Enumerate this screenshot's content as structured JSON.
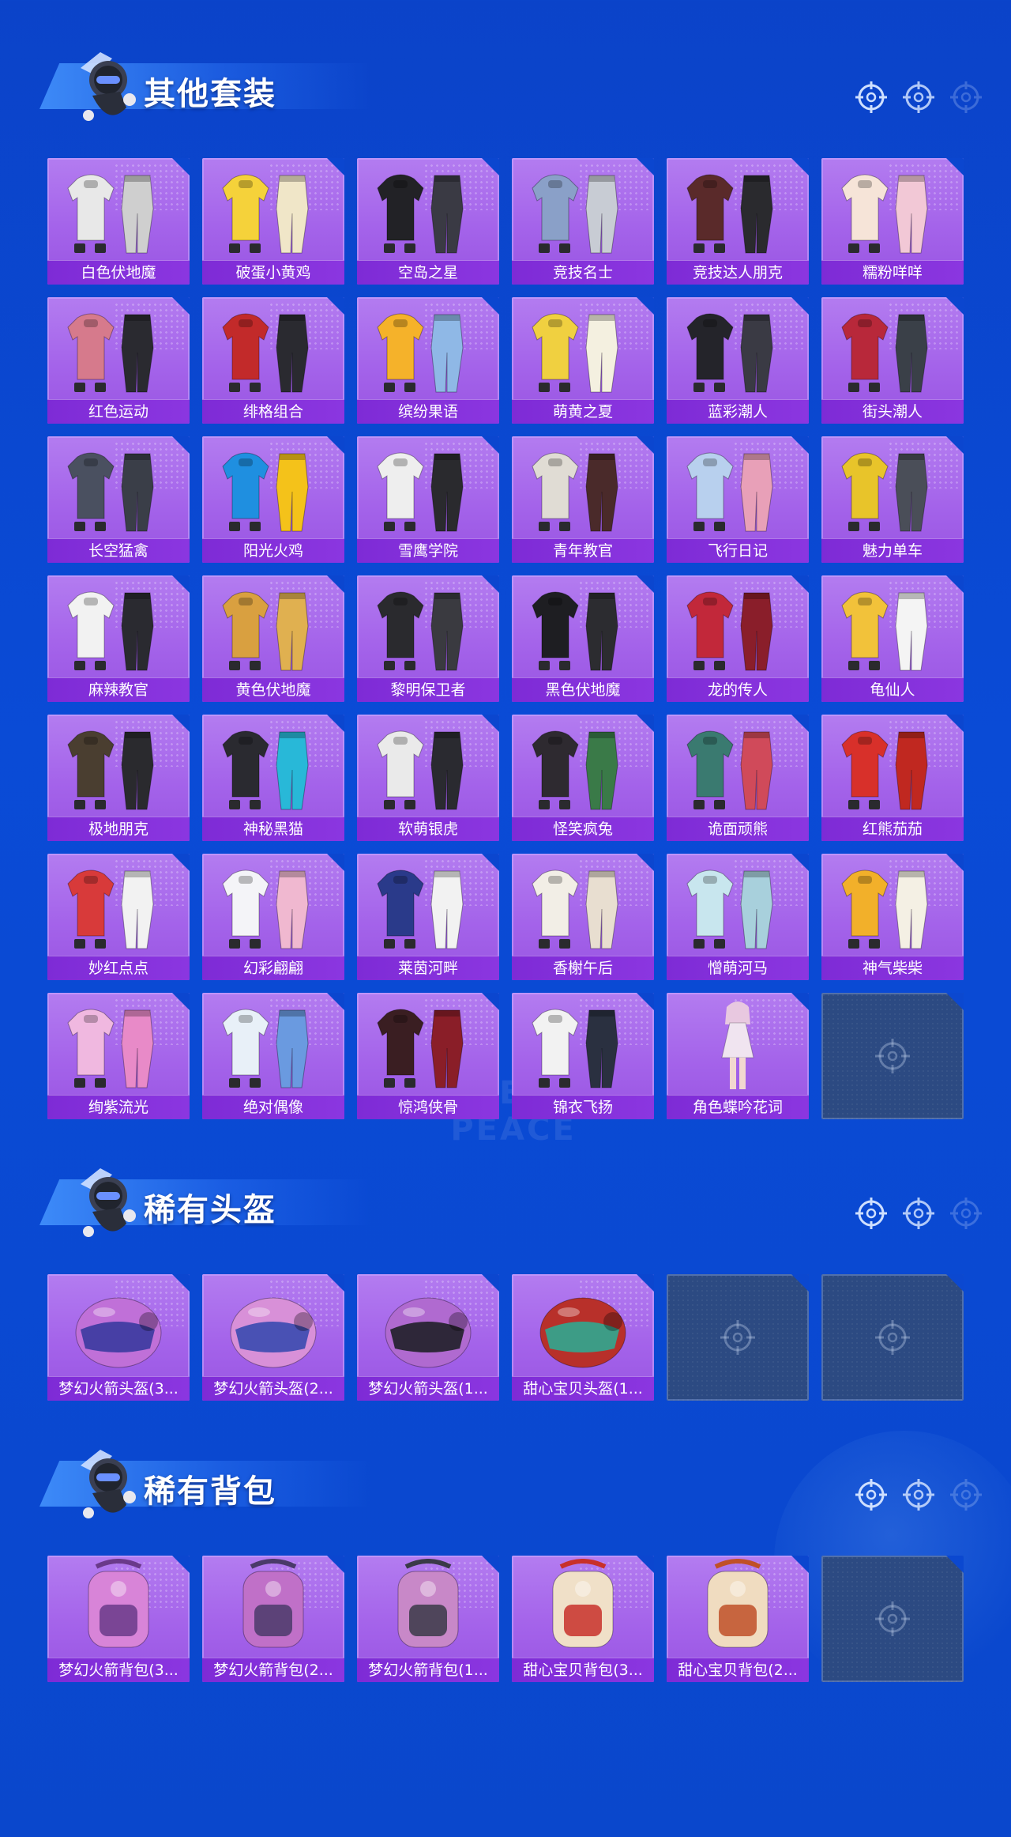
{
  "sections": [
    {
      "title": "其他套装",
      "items": [
        {
          "label": "白色伏地魔",
          "icon": "outfit-icon",
          "color": "#e8e8e8",
          "color2": "#cfcfcf"
        },
        {
          "label": "破蛋小黄鸡",
          "icon": "outfit-icon",
          "color": "#f5d23a",
          "color2": "#f0e6c8"
        },
        {
          "label": "空岛之星",
          "icon": "outfit-icon",
          "color": "#222226",
          "color2": "#3a3a44"
        },
        {
          "label": "竞技名士",
          "icon": "outfit-icon",
          "color": "#8aa0c8",
          "color2": "#c8ccd4"
        },
        {
          "label": "竞技达人朋克",
          "icon": "outfit-icon",
          "color": "#5a2a2a",
          "color2": "#2a2a2e"
        },
        {
          "label": "糯粉咩咩",
          "icon": "outfit-icon",
          "color": "#f6e4d8",
          "color2": "#f2c8d6"
        },
        {
          "label": "红色运动",
          "icon": "outfit-icon",
          "color": "#d67a8c",
          "color2": "#2a2a30"
        },
        {
          "label": "绯格组合",
          "icon": "outfit-icon",
          "color": "#c22a2a",
          "color2": "#2a2a30"
        },
        {
          "label": "缤纷果语",
          "icon": "outfit-icon",
          "color": "#f5b22a",
          "color2": "#8fb8e6"
        },
        {
          "label": "萌黄之夏",
          "icon": "outfit-icon",
          "color": "#f0d040",
          "color2": "#f4f0e0"
        },
        {
          "label": "蓝彩潮人",
          "icon": "outfit-icon",
          "color": "#24242a",
          "color2": "#3a3a44"
        },
        {
          "label": "街头潮人",
          "icon": "outfit-icon",
          "color": "#b8283a",
          "color2": "#3a4048"
        },
        {
          "label": "长空猛禽",
          "icon": "outfit-icon",
          "color": "#4a5060",
          "color2": "#3a3e48"
        },
        {
          "label": "阳光火鸡",
          "icon": "outfit-icon",
          "color": "#1f8fe0",
          "color2": "#f4c21a"
        },
        {
          "label": "雪鹰学院",
          "icon": "outfit-icon",
          "color": "#eeeeee",
          "color2": "#2a2a2e"
        },
        {
          "label": "青年教官",
          "icon": "outfit-icon",
          "color": "#e0dcd4",
          "color2": "#4a2a2a"
        },
        {
          "label": "飞行日记",
          "icon": "outfit-icon",
          "color": "#b8d0ee",
          "color2": "#e8a0b8"
        },
        {
          "label": "魅力单车",
          "icon": "outfit-icon",
          "color": "#e8c42a",
          "color2": "#4a4e58"
        },
        {
          "label": "麻辣教官",
          "icon": "outfit-icon",
          "color": "#f2f2f2",
          "color2": "#2a2a30"
        },
        {
          "label": "黄色伏地魔",
          "icon": "outfit-icon",
          "color": "#d9a040",
          "color2": "#e0b050"
        },
        {
          "label": "黎明保卫者",
          "icon": "outfit-icon",
          "color": "#2a2a2e",
          "color2": "#3a3a40"
        },
        {
          "label": "黑色伏地魔",
          "icon": "outfit-icon",
          "color": "#1e1e22",
          "color2": "#2c2c30"
        },
        {
          "label": "龙的传人",
          "icon": "outfit-icon",
          "color": "#c2283a",
          "color2": "#8a1e2a"
        },
        {
          "label": "龟仙人",
          "icon": "outfit-icon",
          "color": "#f2c23a",
          "color2": "#f4f4f4"
        },
        {
          "label": "极地朋克",
          "icon": "outfit-icon",
          "color": "#4a3e30",
          "color2": "#2a2a2e"
        },
        {
          "label": "神秘黑猫",
          "icon": "outfit-icon",
          "color": "#2a2a30",
          "color2": "#28b8d8"
        },
        {
          "label": "软萌银虎",
          "icon": "outfit-icon",
          "color": "#eaeaea",
          "color2": "#2a2a30"
        },
        {
          "label": "怪笑疯兔",
          "icon": "outfit-icon",
          "color": "#2e2a30",
          "color2": "#3a7a48"
        },
        {
          "label": "诡面顽熊",
          "icon": "outfit-icon",
          "color": "#3a7a70",
          "color2": "#d04a5a"
        },
        {
          "label": "红熊茄茄",
          "icon": "outfit-icon",
          "color": "#d8302a",
          "color2": "#c02820"
        },
        {
          "label": "妙红点点",
          "icon": "outfit-icon",
          "color": "#d83a3a",
          "color2": "#f2f2f2"
        },
        {
          "label": "幻彩翩翩",
          "icon": "outfit-icon",
          "color": "#f4f4f8",
          "color2": "#f0b8d0"
        },
        {
          "label": "莱茵河畔",
          "icon": "outfit-icon",
          "color": "#2a3a8a",
          "color2": "#f2f2f2"
        },
        {
          "label": "香榭午后",
          "icon": "outfit-icon",
          "color": "#f2eee6",
          "color2": "#e8ded0"
        },
        {
          "label": "憎萌河马",
          "icon": "outfit-icon",
          "color": "#c8e6ee",
          "color2": "#a8d0dc"
        },
        {
          "label": "神气柴柴",
          "icon": "outfit-icon",
          "color": "#f2b02a",
          "color2": "#f4f0e4"
        },
        {
          "label": "绚紫流光",
          "icon": "outfit-icon",
          "color": "#f0b8e0",
          "color2": "#e88ac8"
        },
        {
          "label": "绝对偶像",
          "icon": "outfit-icon",
          "color": "#e8f0f8",
          "color2": "#6a9ae0"
        },
        {
          "label": "惊鸿侠骨",
          "icon": "outfit-icon",
          "color": "#3a1e22",
          "color2": "#8a1e28"
        },
        {
          "label": "锦衣飞扬",
          "icon": "outfit-icon",
          "color": "#f2f2f2",
          "color2": "#2a3040"
        },
        {
          "label": "角色蝶吟花词",
          "icon": "character-icon",
          "color": "#f0e4f0",
          "color2": "#e8c8e0"
        },
        {
          "label": "",
          "icon": "empty-slot-icon",
          "empty": true
        }
      ]
    },
    {
      "title": "稀有头盔",
      "items": [
        {
          "label": "梦幻火箭头盔(3...",
          "icon": "helmet-icon",
          "color": "#c070d8",
          "color2": "#3a3aa0"
        },
        {
          "label": "梦幻火箭头盔(2...",
          "icon": "helmet-icon",
          "color": "#d890d8",
          "color2": "#3a4ab0"
        },
        {
          "label": "梦幻火箭头盔(1...",
          "icon": "helmet-icon",
          "color": "#b06ad0",
          "color2": "#202028"
        },
        {
          "label": "甜心宝贝头盔(1...",
          "icon": "helmet-icon",
          "color": "#b8302a",
          "color2": "#30a890"
        },
        {
          "label": "",
          "icon": "empty-slot-icon",
          "empty": true
        },
        {
          "label": "",
          "icon": "empty-slot-icon",
          "empty": true
        }
      ]
    },
    {
      "title": "稀有背包",
      "items": [
        {
          "label": "梦幻火箭背包(3...",
          "icon": "backpack-icon",
          "color": "#d884d8",
          "color2": "#6a3a8a"
        },
        {
          "label": "梦幻火箭背包(2...",
          "icon": "backpack-icon",
          "color": "#c070c8",
          "color2": "#4a3a6a"
        },
        {
          "label": "梦幻火箭背包(1...",
          "icon": "backpack-icon",
          "color": "#c888c8",
          "color2": "#3a3a48"
        },
        {
          "label": "甜心宝贝背包(3...",
          "icon": "backpack-icon",
          "color": "#f0e0c8",
          "color2": "#c8302a"
        },
        {
          "label": "甜心宝贝背包(2...",
          "icon": "backpack-icon",
          "color": "#f0dcc0",
          "color2": "#c05028"
        },
        {
          "label": "",
          "icon": "empty-slot-icon",
          "empty": true
        }
      ]
    }
  ],
  "watermark": "GAME FOR PEACE",
  "colors": {
    "background": "#0a4bd6",
    "card": "#a463ea",
    "label_bar": "#8030d8",
    "empty_card": "#2c4a82"
  }
}
